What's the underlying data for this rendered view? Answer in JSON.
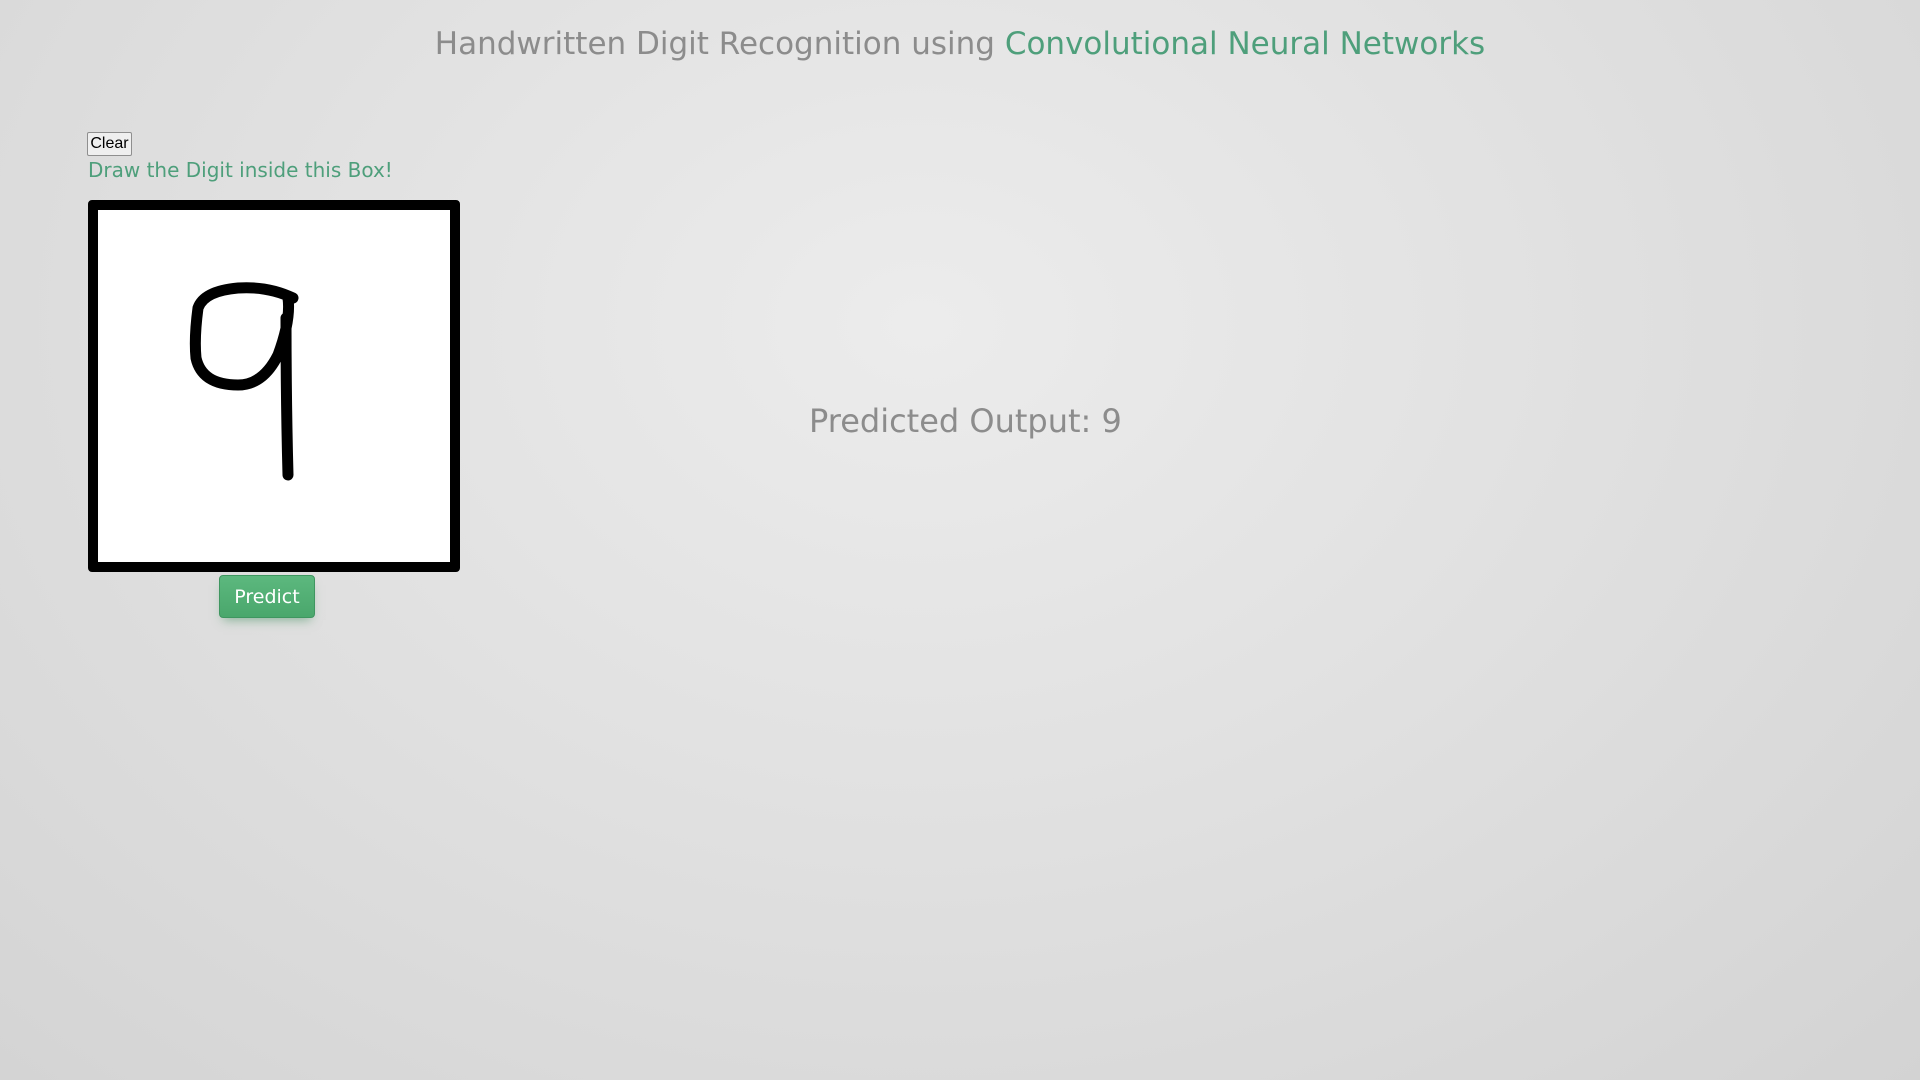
{
  "header": {
    "title_prefix": "Handwritten Digit Recognition using ",
    "title_accent": "Convolutional Neural Networks"
  },
  "controls": {
    "clear_label": "Clear",
    "instruction": "Draw the Digit inside this Box!",
    "predict_label": "Predict"
  },
  "result": {
    "label": "Predicted Output: ",
    "value": "9"
  },
  "colors": {
    "accent": "#4e9f7b",
    "muted_text": "#8c8c8c",
    "button_green": "#5cb87e"
  }
}
